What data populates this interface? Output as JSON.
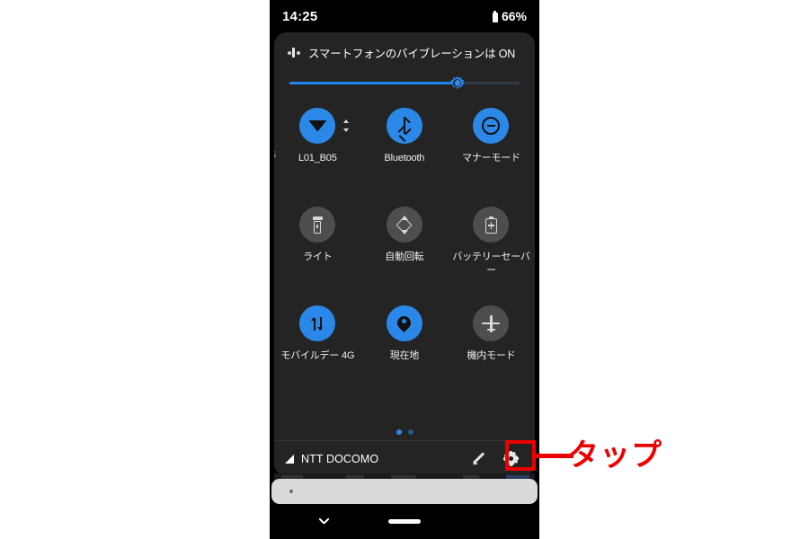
{
  "statusbar": {
    "clock": "14:25",
    "battery_percent": "66%",
    "battery_icon": "battery-icon"
  },
  "vibration_banner": {
    "icon": "vibration-icon",
    "text": "スマートフォンのバイブレーションは ON"
  },
  "brightness_slider": {
    "name": "brightness-slider",
    "thumb_icon": "brightness-sun-icon",
    "value_percent": 73
  },
  "tiles": {
    "rows": [
      [
        {
          "label": "L01_B05",
          "icon": "wifi-icon",
          "state": "on",
          "truncated": true,
          "aux_icon": "wifi-detail-chevrons-icon"
        },
        {
          "label": "Bluetooth",
          "icon": "bluetooth-icon",
          "state": "on",
          "truncated": false
        },
        {
          "label": "マナーモード",
          "icon": "do-not-disturb-icon",
          "state": "on",
          "truncated": false
        }
      ],
      [
        {
          "label": "ライト",
          "icon": "flashlight-icon",
          "state": "off",
          "truncated": false
        },
        {
          "label": "自動回転",
          "icon": "auto-rotate-icon",
          "state": "off",
          "truncated": false
        },
        {
          "label": "バッテリーセーバー",
          "icon": "battery-saver-icon",
          "state": "off",
          "truncated": false
        }
      ],
      [
        {
          "label": "モバイルデー 4G",
          "icon": "mobile-data-icon",
          "state": "on",
          "truncated": false
        },
        {
          "label": "現在地",
          "icon": "location-pin-icon",
          "state": "on",
          "truncated": false
        },
        {
          "label": "機内モード",
          "icon": "airplane-icon",
          "state": "off",
          "truncated": false
        }
      ]
    ],
    "edge_sliver_label": "5"
  },
  "page_dots": {
    "count": 2,
    "active_index": 0
  },
  "footer": {
    "signal_icon": "signal-triangle-icon",
    "carrier": "NTT DOCOMO",
    "edit_icon": "pencil-edit-icon",
    "settings_icon": "gear-settings-icon"
  },
  "input_sheet": {
    "name": "text-input-sheet",
    "caret_dot": "caret-dot"
  },
  "navbar": {
    "back_icon": "chevron-down-back-icon",
    "home_icon": "home-pill-icon"
  },
  "annotation": {
    "text": "タップ",
    "color": "#ee0000",
    "highlight_target": "gear-settings-icon"
  },
  "colors": {
    "accent_blue": "#2b88e8",
    "slider_blue": "#1f86ef",
    "tile_off": "#4e4e4e",
    "panel_bg": "#242424",
    "phone_bg": "#000000",
    "annotation_red": "#ee0000",
    "sheet_bg": "#d9dadc"
  }
}
